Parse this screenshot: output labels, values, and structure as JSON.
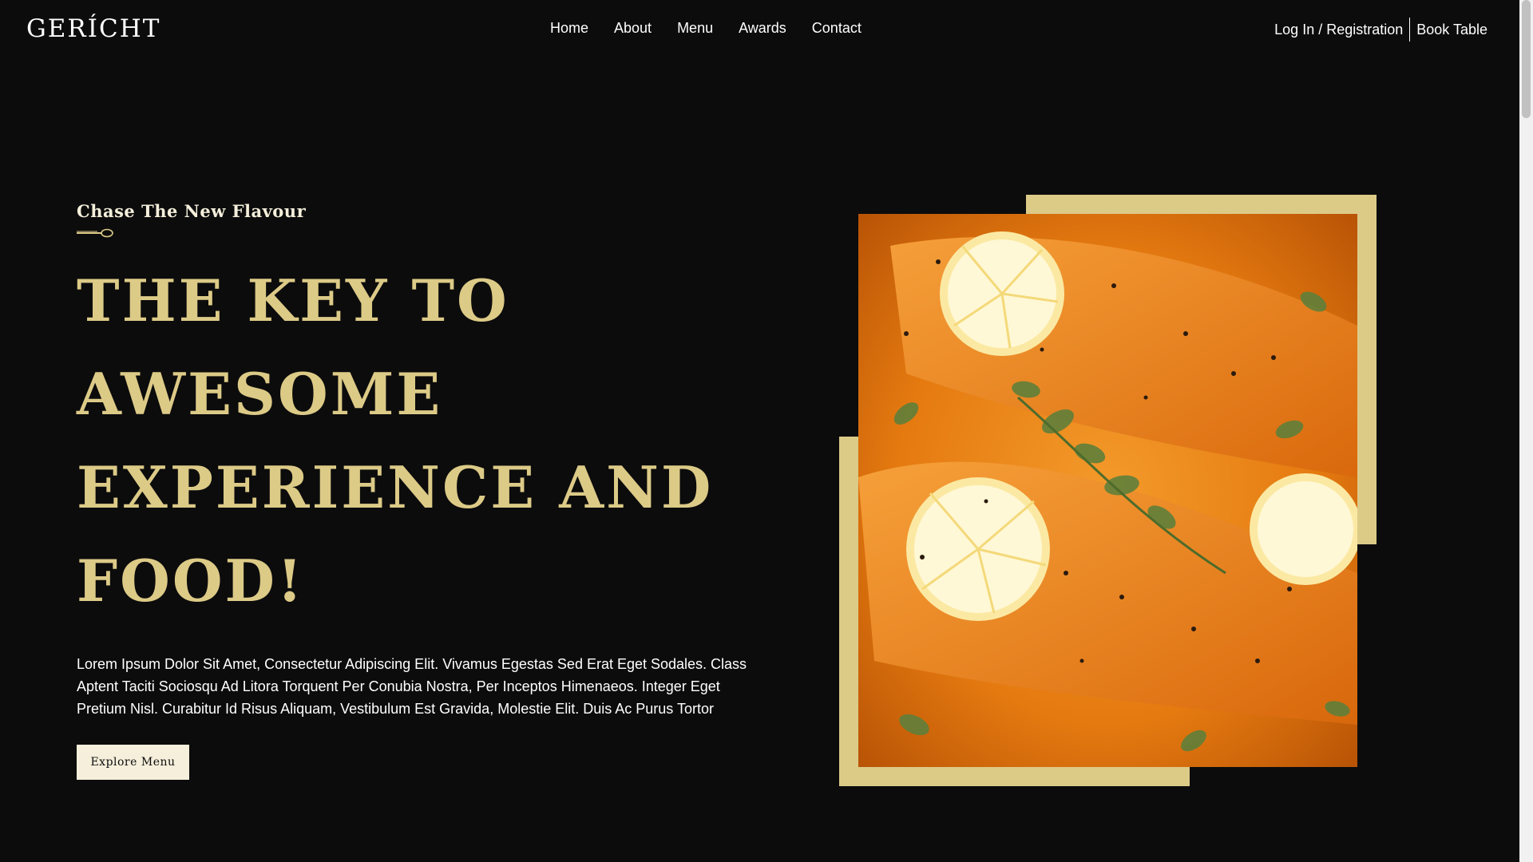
{
  "brand": {
    "logo": "GERÍCHT"
  },
  "nav": {
    "links": [
      "Home",
      "About",
      "Menu",
      "Awards",
      "Contact"
    ],
    "login": "Log In / Registration",
    "book": "Book Table"
  },
  "hero": {
    "subtitle": "Chase The New Flavour",
    "headline_lines": [
      "THE KEY TO",
      "AWESOME",
      "EXPERIENCE AND",
      "FOOD!"
    ],
    "description": "Lorem Ipsum Dolor Sit Amet, Consectetur Adipiscing Elit. Vivamus Egestas Sed Erat Eget Sodales. Class Aptent Taciti Sociosqu Ad Litora Torquent Per Conubia Nostra, Per Inceptos Himenaeos. Integer Eget Pretium Nisl. Curabitur Id Risus Aliquam, Vestibulum Est Gravida, Molestie Elit. Duis Ac Purus Tortor",
    "button": "Explore Menu"
  },
  "colors": {
    "background": "#0c0c0c",
    "golden": "#dcca87",
    "cream": "#f5efdb"
  },
  "icons": {
    "spoon": "spoon-icon"
  }
}
